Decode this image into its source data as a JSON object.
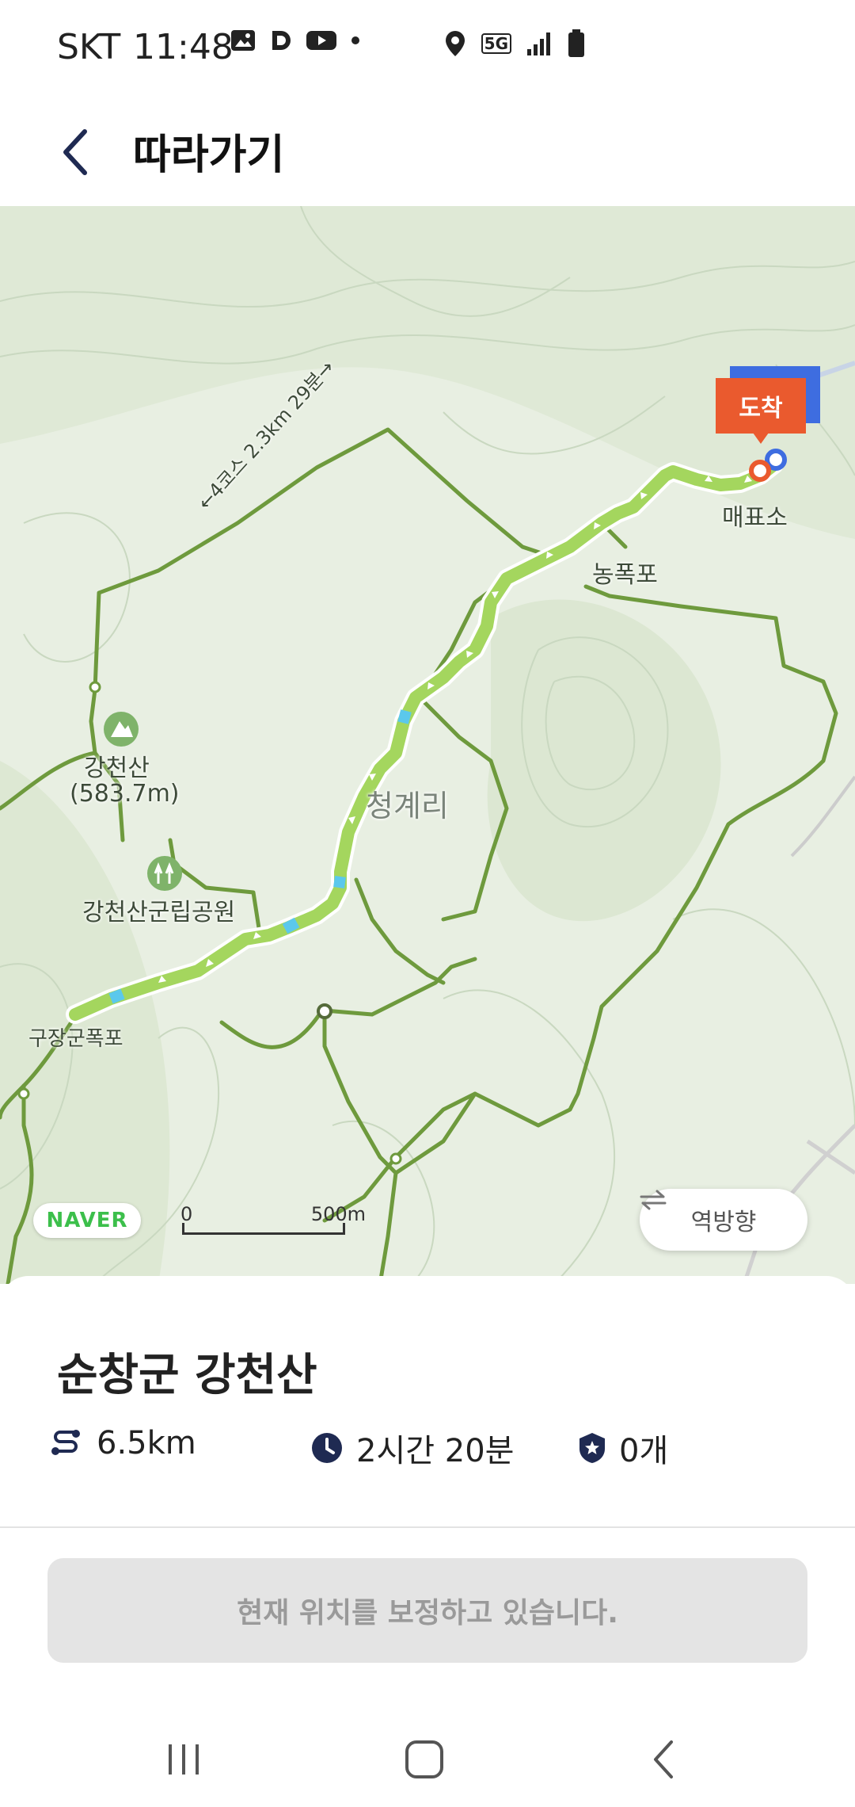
{
  "status_bar": {
    "carrier": "SKT",
    "time": "11:48",
    "network": "5G"
  },
  "header": {
    "title": "따라가기",
    "back_icon": "chevron-left-icon"
  },
  "map": {
    "labels": {
      "arrival": "도착",
      "ticket_office": "매표소",
      "waterfall_right": "농폭포",
      "mountain": "강천산",
      "mountain_height": "(583.7m)",
      "park": "강천산군립공원",
      "valley": "청계리",
      "waterfall_left": "구장군폭포",
      "trail_note": "←4코스 2.3km 29분→"
    },
    "provider": "NAVER",
    "scale": {
      "start": "0",
      "end": "500m"
    },
    "reverse_button": "역방향",
    "colors": {
      "route": "#a4d65e",
      "trail": "#6e9a3d",
      "arrival": "#ea5a2e",
      "start": "#3e6de0"
    }
  },
  "course": {
    "name": "순창군 강천산",
    "distance": "6.5km",
    "duration": "2시간 20분",
    "stamps": "0개"
  },
  "status_message": "현재 위치를 보정하고 있습니다.",
  "nav_bar": {
    "recents": "recents-icon",
    "home": "home-icon",
    "back": "back-icon"
  }
}
